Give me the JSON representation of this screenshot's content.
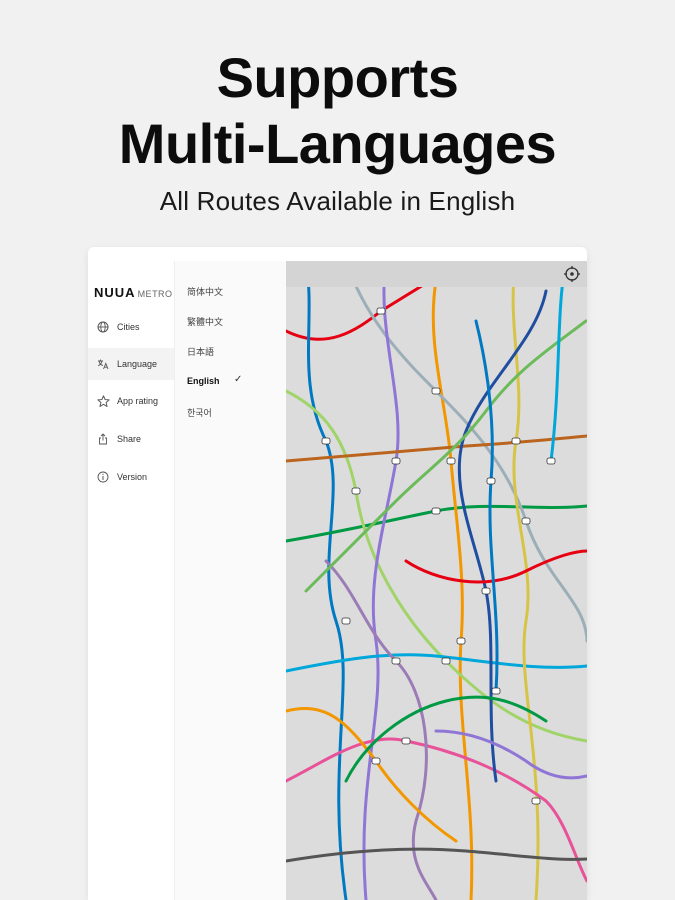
{
  "header": {
    "title_line1": "Supports",
    "title_line2": "Multi-Languages",
    "subtitle": "All Routes Available in English"
  },
  "app": {
    "logo_brand": "NUUA",
    "logo_suffix": "METRO"
  },
  "sidebar": {
    "items": [
      {
        "label": "Cities",
        "icon": "globe-icon"
      },
      {
        "label": "Language",
        "icon": "translate-icon"
      },
      {
        "label": "App rating",
        "icon": "star-icon"
      },
      {
        "label": "Share",
        "icon": "share-icon"
      },
      {
        "label": "Version",
        "icon": "info-icon"
      }
    ],
    "active_index": 1
  },
  "languages": {
    "options": [
      "简体中文",
      "繁體中文",
      "日本語",
      "English",
      "한국어"
    ],
    "selected": "English",
    "check_mark": "✓"
  },
  "map": {
    "locate_icon": "crosshair-icon",
    "line_colors": [
      "#e60012",
      "#0079c2",
      "#009944",
      "#f39700",
      "#9caeb7",
      "#a0d468",
      "#8f76d6",
      "#00a7db",
      "#d7c447",
      "#e85298",
      "#9b7cb6",
      "#bb641d",
      "#1f4ea1",
      "#6cbb5a",
      "#555555"
    ]
  }
}
